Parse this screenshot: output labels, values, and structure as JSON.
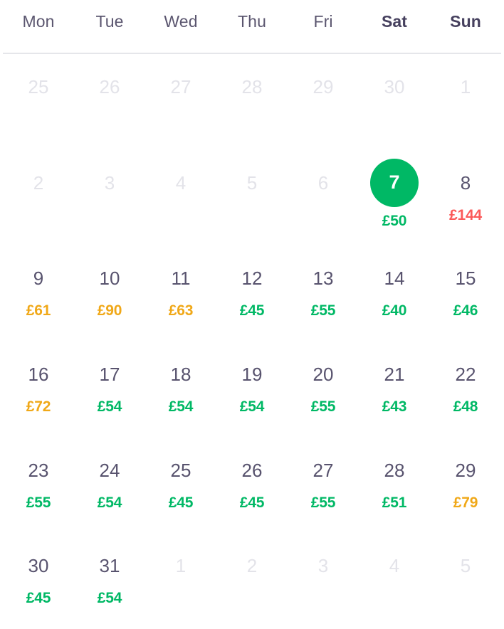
{
  "calendar": {
    "currency_symbol": "£",
    "colors": {
      "price_low": "#00b865",
      "price_mid": "#f0a818",
      "price_high": "#fb5a5a",
      "day_text": "#58536e",
      "day_muted": "#e3e3e9",
      "selected_bg": "#00b865",
      "selected_text": "#ffffff",
      "header_divider": "#e5e6ea"
    },
    "weekdays": [
      {
        "label": "Mon",
        "weekend": false
      },
      {
        "label": "Tue",
        "weekend": false
      },
      {
        "label": "Wed",
        "weekend": false
      },
      {
        "label": "Thu",
        "weekend": false
      },
      {
        "label": "Fri",
        "weekend": false
      },
      {
        "label": "Sat",
        "weekend": true
      },
      {
        "label": "Sun",
        "weekend": true
      }
    ],
    "weeks": [
      [
        {
          "day": "25",
          "price": "",
          "tier": "",
          "muted": true,
          "selected": false
        },
        {
          "day": "26",
          "price": "",
          "tier": "",
          "muted": true,
          "selected": false
        },
        {
          "day": "27",
          "price": "",
          "tier": "",
          "muted": true,
          "selected": false
        },
        {
          "day": "28",
          "price": "",
          "tier": "",
          "muted": true,
          "selected": false
        },
        {
          "day": "29",
          "price": "",
          "tier": "",
          "muted": true,
          "selected": false
        },
        {
          "day": "30",
          "price": "",
          "tier": "",
          "muted": true,
          "selected": false
        },
        {
          "day": "1",
          "price": "",
          "tier": "",
          "muted": true,
          "selected": false
        }
      ],
      [
        {
          "day": "2",
          "price": "",
          "tier": "",
          "muted": true,
          "selected": false
        },
        {
          "day": "3",
          "price": "",
          "tier": "",
          "muted": true,
          "selected": false
        },
        {
          "day": "4",
          "price": "",
          "tier": "",
          "muted": true,
          "selected": false
        },
        {
          "day": "5",
          "price": "",
          "tier": "",
          "muted": true,
          "selected": false
        },
        {
          "day": "6",
          "price": "",
          "tier": "",
          "muted": true,
          "selected": false
        },
        {
          "day": "7",
          "price": "£50",
          "tier": "low",
          "muted": false,
          "selected": true
        },
        {
          "day": "8",
          "price": "£144",
          "tier": "high",
          "muted": false,
          "selected": false
        }
      ],
      [
        {
          "day": "9",
          "price": "£61",
          "tier": "mid",
          "muted": false,
          "selected": false
        },
        {
          "day": "10",
          "price": "£90",
          "tier": "mid",
          "muted": false,
          "selected": false
        },
        {
          "day": "11",
          "price": "£63",
          "tier": "mid",
          "muted": false,
          "selected": false
        },
        {
          "day": "12",
          "price": "£45",
          "tier": "low",
          "muted": false,
          "selected": false
        },
        {
          "day": "13",
          "price": "£55",
          "tier": "low",
          "muted": false,
          "selected": false
        },
        {
          "day": "14",
          "price": "£40",
          "tier": "low",
          "muted": false,
          "selected": false
        },
        {
          "day": "15",
          "price": "£46",
          "tier": "low",
          "muted": false,
          "selected": false
        }
      ],
      [
        {
          "day": "16",
          "price": "£72",
          "tier": "mid",
          "muted": false,
          "selected": false
        },
        {
          "day": "17",
          "price": "£54",
          "tier": "low",
          "muted": false,
          "selected": false
        },
        {
          "day": "18",
          "price": "£54",
          "tier": "low",
          "muted": false,
          "selected": false
        },
        {
          "day": "19",
          "price": "£54",
          "tier": "low",
          "muted": false,
          "selected": false
        },
        {
          "day": "20",
          "price": "£55",
          "tier": "low",
          "muted": false,
          "selected": false
        },
        {
          "day": "21",
          "price": "£43",
          "tier": "low",
          "muted": false,
          "selected": false
        },
        {
          "day": "22",
          "price": "£48",
          "tier": "low",
          "muted": false,
          "selected": false
        }
      ],
      [
        {
          "day": "23",
          "price": "£55",
          "tier": "low",
          "muted": false,
          "selected": false
        },
        {
          "day": "24",
          "price": "£54",
          "tier": "low",
          "muted": false,
          "selected": false
        },
        {
          "day": "25",
          "price": "£45",
          "tier": "low",
          "muted": false,
          "selected": false
        },
        {
          "day": "26",
          "price": "£45",
          "tier": "low",
          "muted": false,
          "selected": false
        },
        {
          "day": "27",
          "price": "£55",
          "tier": "low",
          "muted": false,
          "selected": false
        },
        {
          "day": "28",
          "price": "£51",
          "tier": "low",
          "muted": false,
          "selected": false
        },
        {
          "day": "29",
          "price": "£79",
          "tier": "mid",
          "muted": false,
          "selected": false
        }
      ],
      [
        {
          "day": "30",
          "price": "£45",
          "tier": "low",
          "muted": false,
          "selected": false
        },
        {
          "day": "31",
          "price": "£54",
          "tier": "low",
          "muted": false,
          "selected": false
        },
        {
          "day": "1",
          "price": "",
          "tier": "",
          "muted": true,
          "selected": false
        },
        {
          "day": "2",
          "price": "",
          "tier": "",
          "muted": true,
          "selected": false
        },
        {
          "day": "3",
          "price": "",
          "tier": "",
          "muted": true,
          "selected": false
        },
        {
          "day": "4",
          "price": "",
          "tier": "",
          "muted": true,
          "selected": false
        },
        {
          "day": "5",
          "price": "",
          "tier": "",
          "muted": true,
          "selected": false
        }
      ]
    ]
  }
}
